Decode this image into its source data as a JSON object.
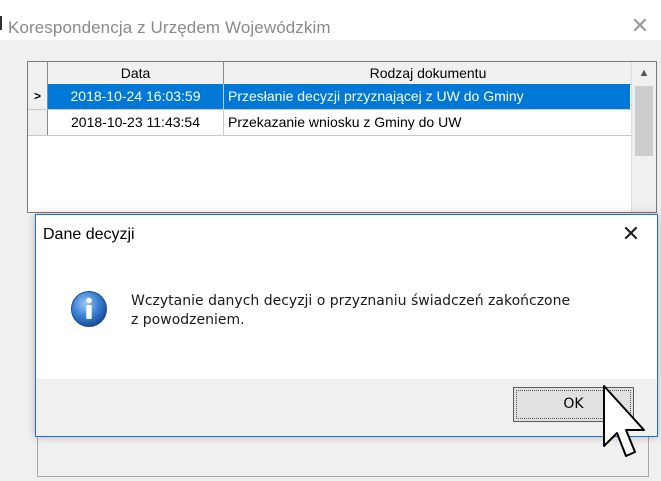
{
  "parent_window": {
    "title": "Korespondencja z Urzędem Wojewódzkim",
    "close_glyph": "✕"
  },
  "grid": {
    "columns": [
      "Data",
      "Rodzaj dokumentu"
    ],
    "rows": [
      {
        "indicator": ">",
        "date": "2018-10-24 16:03:59",
        "type": "Przesłanie decyzji przyznającej z UW do Gminy",
        "selected": true
      },
      {
        "indicator": "",
        "date": "2018-10-23 11:43:54",
        "type": "Przekazanie wniosku z Gminy do UW",
        "selected": false
      }
    ]
  },
  "dialog": {
    "title": "Dane decyzji",
    "close_glyph": "✕",
    "icon": "information-icon",
    "message_line1": "Wczytanie danych decyzji o przyznaniu świadczeń zakończone",
    "message_line2": "z powodzeniem.",
    "ok_label": "OK"
  },
  "colors": {
    "selection": "#0078d7",
    "dialog_border": "#1f6fc4",
    "info_icon": "#2b6fc8"
  }
}
